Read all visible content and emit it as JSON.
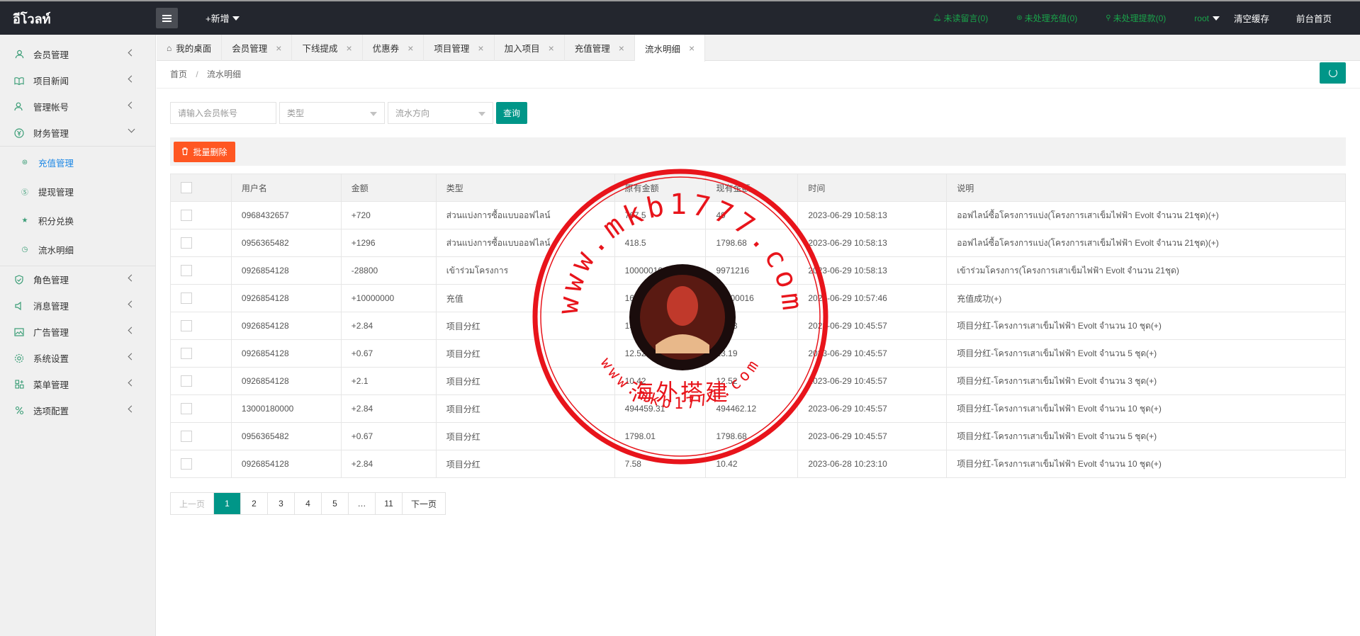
{
  "header": {
    "logo": "อีโวลท์",
    "new_label": "+新增",
    "links": [
      {
        "label": "未读留言(0)",
        "icon": "bell-icon"
      },
      {
        "label": "未处理充值(0)",
        "icon": "wallet-icon"
      },
      {
        "label": "未处理提款(0)",
        "icon": "location-icon"
      }
    ],
    "user": "root",
    "clear_cache": "清空缓存",
    "front_home": "前台首页",
    "link_color": "#1aa34a"
  },
  "sidebar": {
    "items": [
      {
        "label": "会员管理",
        "icon": "user-icon"
      },
      {
        "label": "项目新闻",
        "icon": "book-icon"
      },
      {
        "label": "管理帐号",
        "icon": "user-group-icon"
      },
      {
        "label": "财务管理",
        "icon": "finance-icon"
      }
    ],
    "sub_items": [
      {
        "label": "充值管理",
        "icon": "recharge-icon"
      },
      {
        "label": "提现管理",
        "icon": "withdraw-icon"
      },
      {
        "label": "积分兑换",
        "icon": "star-icon"
      },
      {
        "label": "流水明细",
        "icon": "clock-icon"
      }
    ],
    "items2": [
      {
        "label": "角色管理",
        "icon": "shield-icon"
      },
      {
        "label": "消息管理",
        "icon": "speaker-icon"
      },
      {
        "label": "广告管理",
        "icon": "image-icon"
      },
      {
        "label": "系统设置",
        "icon": "gear-icon"
      },
      {
        "label": "菜单管理",
        "icon": "menu-grid-icon"
      },
      {
        "label": "选项配置",
        "icon": "options-icon"
      }
    ]
  },
  "tabs": [
    {
      "label": "我的桌面"
    },
    {
      "label": "会员管理"
    },
    {
      "label": "下线提成"
    },
    {
      "label": "优惠券"
    },
    {
      "label": "项目管理"
    },
    {
      "label": "加入项目"
    },
    {
      "label": "充值管理"
    },
    {
      "label": "流水明细"
    }
  ],
  "breadcrumb": {
    "home": "首页",
    "sep": "/",
    "current": "流水明细"
  },
  "search": {
    "account_placeholder": "请输入会员帐号",
    "type_placeholder": "类型",
    "direction_placeholder": "流水方向",
    "query_label": "查询"
  },
  "toolbar": {
    "batch_delete": "批量删除"
  },
  "table": {
    "headers": [
      "用户名",
      "金额",
      "类型",
      "原有金额",
      "现有金额",
      "时间",
      "说明"
    ],
    "rows": [
      {
        "user": "0968432657",
        "amount": "+720",
        "sign": "pos",
        "type": "ส่วนแบ่งการซื้อแบบออฟไลน์",
        "before": "767.5",
        "after": "49",
        "time": "2023-06-29 10:58:13",
        "note": "ออฟไลน์ซื้อโครงการแบ่ง(โครงการเสาเข็มไฟฟ้า Evolt จำนวน 21ชุด)(+)"
      },
      {
        "user": "0956365482",
        "amount": "+1296",
        "sign": "pos",
        "type": "ส่วนแบ่งการซื้อแบบออฟไลน์",
        "before": "418.5",
        "after": "1798.68",
        "time": "2023-06-29 10:58:13",
        "note": "ออฟไลน์ซื้อโครงการแบ่ง(โครงการเสาเข็มไฟฟ้า Evolt จำนวน 21ชุด)(+)"
      },
      {
        "user": "0926854128",
        "amount": "-28800",
        "sign": "neg",
        "type": "เข้าร่วมโครงการ",
        "before": "10000016",
        "after": "9971216",
        "time": "2023-06-29 10:58:13",
        "note": "เข้าร่วมโครงการ(โครงการเสาเข็มไฟฟ้า Evolt จำนวน 21ชุด)"
      },
      {
        "user": "0926854128",
        "amount": "+10000000",
        "sign": "pos",
        "type": "充值",
        "before": "16",
        "after": "10000016",
        "time": "2023-06-29 10:57:46",
        "note": "充值成功(+)"
      },
      {
        "user": "0926854128",
        "amount": "+2.84",
        "sign": "pos",
        "type": "项目分红",
        "before": "13.19",
        "after": "16.03",
        "time": "2023-06-29 10:45:57",
        "note": "项目分红-โครงการเสาเข็มไฟฟ้า Evolt จำนวน 10 ชุด(+)"
      },
      {
        "user": "0926854128",
        "amount": "+0.67",
        "sign": "pos",
        "type": "项目分红",
        "before": "12.52",
        "after": "13.19",
        "time": "2023-06-29 10:45:57",
        "note": "项目分红-โครงการเสาเข็มไฟฟ้า Evolt จำนวน 5 ชุด(+)"
      },
      {
        "user": "0926854128",
        "amount": "+2.1",
        "sign": "pos",
        "type": "项目分红",
        "before": "10.42",
        "after": "12.52",
        "time": "2023-06-29 10:45:57",
        "note": "项目分红-โครงการเสาเข็มไฟฟ้า Evolt จำนวน 3 ชุด(+)"
      },
      {
        "user": "13000180000",
        "amount": "+2.84",
        "sign": "pos",
        "type": "项目分红",
        "before": "494459.31",
        "after": "494462.12",
        "time": "2023-06-29 10:45:57",
        "note": "项目分红-โครงการเสาเข็มไฟฟ้า Evolt จำนวน 10 ชุด(+)"
      },
      {
        "user": "0956365482",
        "amount": "+0.67",
        "sign": "pos",
        "type": "项目分红",
        "before": "1798.01",
        "after": "1798.68",
        "time": "2023-06-29 10:45:57",
        "note": "项目分红-โครงการเสาเข็มไฟฟ้า Evolt จำนวน 5 ชุด(+)"
      },
      {
        "user": "0926854128",
        "amount": "+2.84",
        "sign": "pos",
        "type": "项目分红",
        "before": "7.58",
        "after": "10.42",
        "time": "2023-06-28 10:23:10",
        "note": "项目分红-โครงการเสาเข็มไฟฟ้า Evolt จำนวน 10 ชุด(+)"
      }
    ]
  },
  "pagination": {
    "prev": "上一页",
    "pages": [
      "1",
      "2",
      "3",
      "4",
      "5",
      "…",
      "11"
    ],
    "current": "1",
    "next": "下一页"
  },
  "watermark": {
    "url_top": "www.mkb1777.com",
    "url_bottom": "www.mkb1777.com",
    "center_text": "海外搭建",
    "color": "#e8141b"
  },
  "colors": {
    "accent": "#009688",
    "danger": "#ff5722",
    "positive": "#1a8a1a",
    "negative": "#ff2222"
  }
}
